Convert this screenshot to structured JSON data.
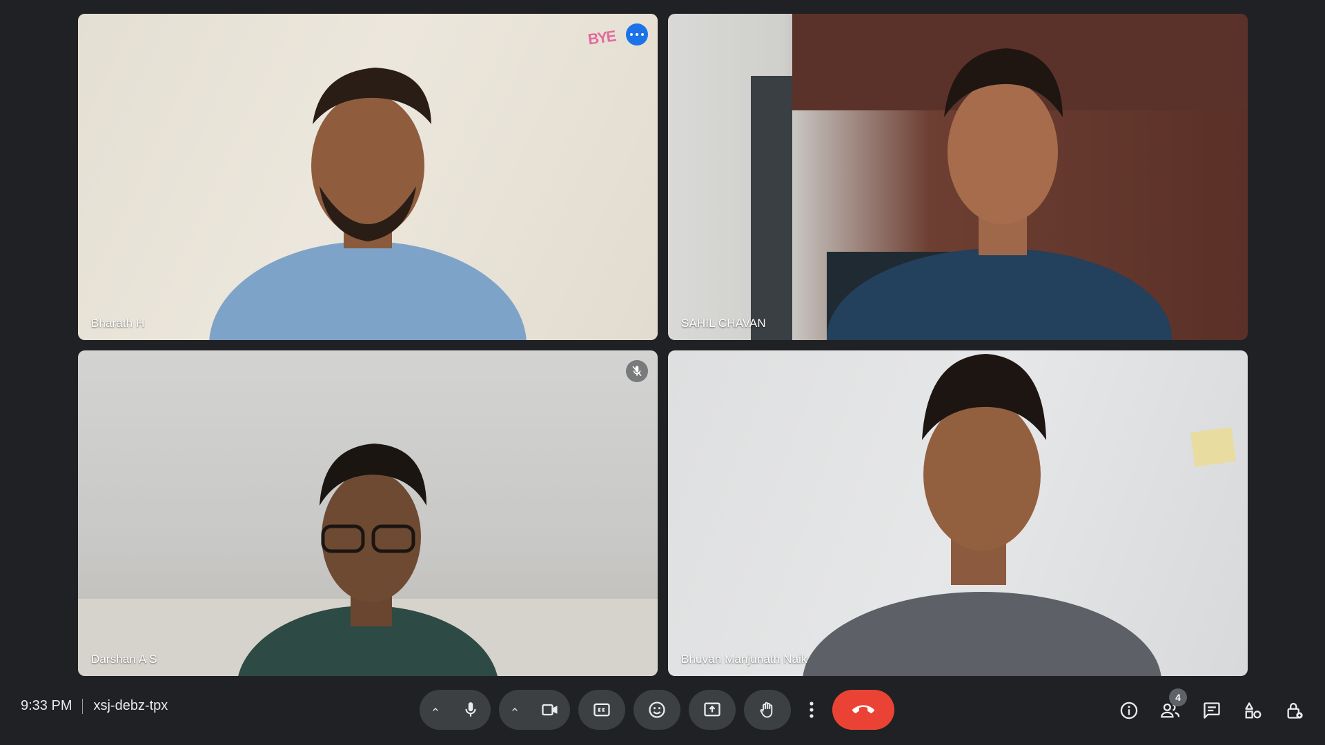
{
  "participants": [
    {
      "name": "Bharath H",
      "speaking": true
    },
    {
      "name": "SAHIL CHAVAN",
      "speaking": false
    },
    {
      "name": "Darshan A S",
      "muted": true
    },
    {
      "name": "Bhuvan Manjunath Naik",
      "speaking": false
    }
  ],
  "tile1_sticker": "BYE",
  "meeting": {
    "time": "9:33 PM",
    "code": "xsj-debz-tpx"
  },
  "people_count": "4",
  "colors": {
    "background": "#202124",
    "control_bg": "#3c4043",
    "end_call": "#ea4335",
    "speaking_outline": "#4d8df0",
    "accent_blue": "#1a73e8"
  },
  "icons": {
    "mic": "mic-icon",
    "camera": "videocam-icon",
    "captions": "closed-captions-icon",
    "reactions": "emoji-icon",
    "present": "present-screen-icon",
    "raise_hand": "raise-hand-icon",
    "more": "more-vert-icon",
    "end_call": "call-end-icon",
    "info": "info-icon",
    "people": "people-icon",
    "chat": "chat-icon",
    "activities": "activities-icon",
    "host_controls": "host-controls-lock-icon"
  }
}
